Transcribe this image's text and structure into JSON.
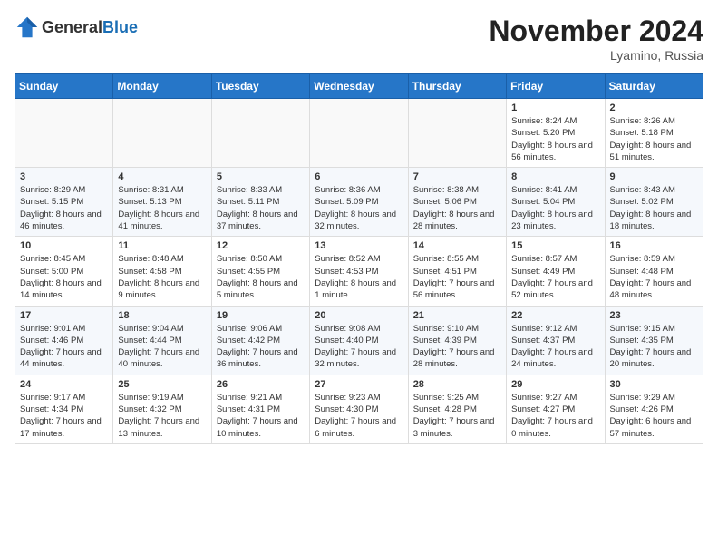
{
  "header": {
    "logo_general": "General",
    "logo_blue": "Blue",
    "month_title": "November 2024",
    "location": "Lyamino, Russia"
  },
  "days_of_week": [
    "Sunday",
    "Monday",
    "Tuesday",
    "Wednesday",
    "Thursday",
    "Friday",
    "Saturday"
  ],
  "weeks": [
    [
      {
        "day": "",
        "info": ""
      },
      {
        "day": "",
        "info": ""
      },
      {
        "day": "",
        "info": ""
      },
      {
        "day": "",
        "info": ""
      },
      {
        "day": "",
        "info": ""
      },
      {
        "day": "1",
        "info": "Sunrise: 8:24 AM\nSunset: 5:20 PM\nDaylight: 8 hours and 56 minutes."
      },
      {
        "day": "2",
        "info": "Sunrise: 8:26 AM\nSunset: 5:18 PM\nDaylight: 8 hours and 51 minutes."
      }
    ],
    [
      {
        "day": "3",
        "info": "Sunrise: 8:29 AM\nSunset: 5:15 PM\nDaylight: 8 hours and 46 minutes."
      },
      {
        "day": "4",
        "info": "Sunrise: 8:31 AM\nSunset: 5:13 PM\nDaylight: 8 hours and 41 minutes."
      },
      {
        "day": "5",
        "info": "Sunrise: 8:33 AM\nSunset: 5:11 PM\nDaylight: 8 hours and 37 minutes."
      },
      {
        "day": "6",
        "info": "Sunrise: 8:36 AM\nSunset: 5:09 PM\nDaylight: 8 hours and 32 minutes."
      },
      {
        "day": "7",
        "info": "Sunrise: 8:38 AM\nSunset: 5:06 PM\nDaylight: 8 hours and 28 minutes."
      },
      {
        "day": "8",
        "info": "Sunrise: 8:41 AM\nSunset: 5:04 PM\nDaylight: 8 hours and 23 minutes."
      },
      {
        "day": "9",
        "info": "Sunrise: 8:43 AM\nSunset: 5:02 PM\nDaylight: 8 hours and 18 minutes."
      }
    ],
    [
      {
        "day": "10",
        "info": "Sunrise: 8:45 AM\nSunset: 5:00 PM\nDaylight: 8 hours and 14 minutes."
      },
      {
        "day": "11",
        "info": "Sunrise: 8:48 AM\nSunset: 4:58 PM\nDaylight: 8 hours and 9 minutes."
      },
      {
        "day": "12",
        "info": "Sunrise: 8:50 AM\nSunset: 4:55 PM\nDaylight: 8 hours and 5 minutes."
      },
      {
        "day": "13",
        "info": "Sunrise: 8:52 AM\nSunset: 4:53 PM\nDaylight: 8 hours and 1 minute."
      },
      {
        "day": "14",
        "info": "Sunrise: 8:55 AM\nSunset: 4:51 PM\nDaylight: 7 hours and 56 minutes."
      },
      {
        "day": "15",
        "info": "Sunrise: 8:57 AM\nSunset: 4:49 PM\nDaylight: 7 hours and 52 minutes."
      },
      {
        "day": "16",
        "info": "Sunrise: 8:59 AM\nSunset: 4:48 PM\nDaylight: 7 hours and 48 minutes."
      }
    ],
    [
      {
        "day": "17",
        "info": "Sunrise: 9:01 AM\nSunset: 4:46 PM\nDaylight: 7 hours and 44 minutes."
      },
      {
        "day": "18",
        "info": "Sunrise: 9:04 AM\nSunset: 4:44 PM\nDaylight: 7 hours and 40 minutes."
      },
      {
        "day": "19",
        "info": "Sunrise: 9:06 AM\nSunset: 4:42 PM\nDaylight: 7 hours and 36 minutes."
      },
      {
        "day": "20",
        "info": "Sunrise: 9:08 AM\nSunset: 4:40 PM\nDaylight: 7 hours and 32 minutes."
      },
      {
        "day": "21",
        "info": "Sunrise: 9:10 AM\nSunset: 4:39 PM\nDaylight: 7 hours and 28 minutes."
      },
      {
        "day": "22",
        "info": "Sunrise: 9:12 AM\nSunset: 4:37 PM\nDaylight: 7 hours and 24 minutes."
      },
      {
        "day": "23",
        "info": "Sunrise: 9:15 AM\nSunset: 4:35 PM\nDaylight: 7 hours and 20 minutes."
      }
    ],
    [
      {
        "day": "24",
        "info": "Sunrise: 9:17 AM\nSunset: 4:34 PM\nDaylight: 7 hours and 17 minutes."
      },
      {
        "day": "25",
        "info": "Sunrise: 9:19 AM\nSunset: 4:32 PM\nDaylight: 7 hours and 13 minutes."
      },
      {
        "day": "26",
        "info": "Sunrise: 9:21 AM\nSunset: 4:31 PM\nDaylight: 7 hours and 10 minutes."
      },
      {
        "day": "27",
        "info": "Sunrise: 9:23 AM\nSunset: 4:30 PM\nDaylight: 7 hours and 6 minutes."
      },
      {
        "day": "28",
        "info": "Sunrise: 9:25 AM\nSunset: 4:28 PM\nDaylight: 7 hours and 3 minutes."
      },
      {
        "day": "29",
        "info": "Sunrise: 9:27 AM\nSunset: 4:27 PM\nDaylight: 7 hours and 0 minutes."
      },
      {
        "day": "30",
        "info": "Sunrise: 9:29 AM\nSunset: 4:26 PM\nDaylight: 6 hours and 57 minutes."
      }
    ]
  ]
}
